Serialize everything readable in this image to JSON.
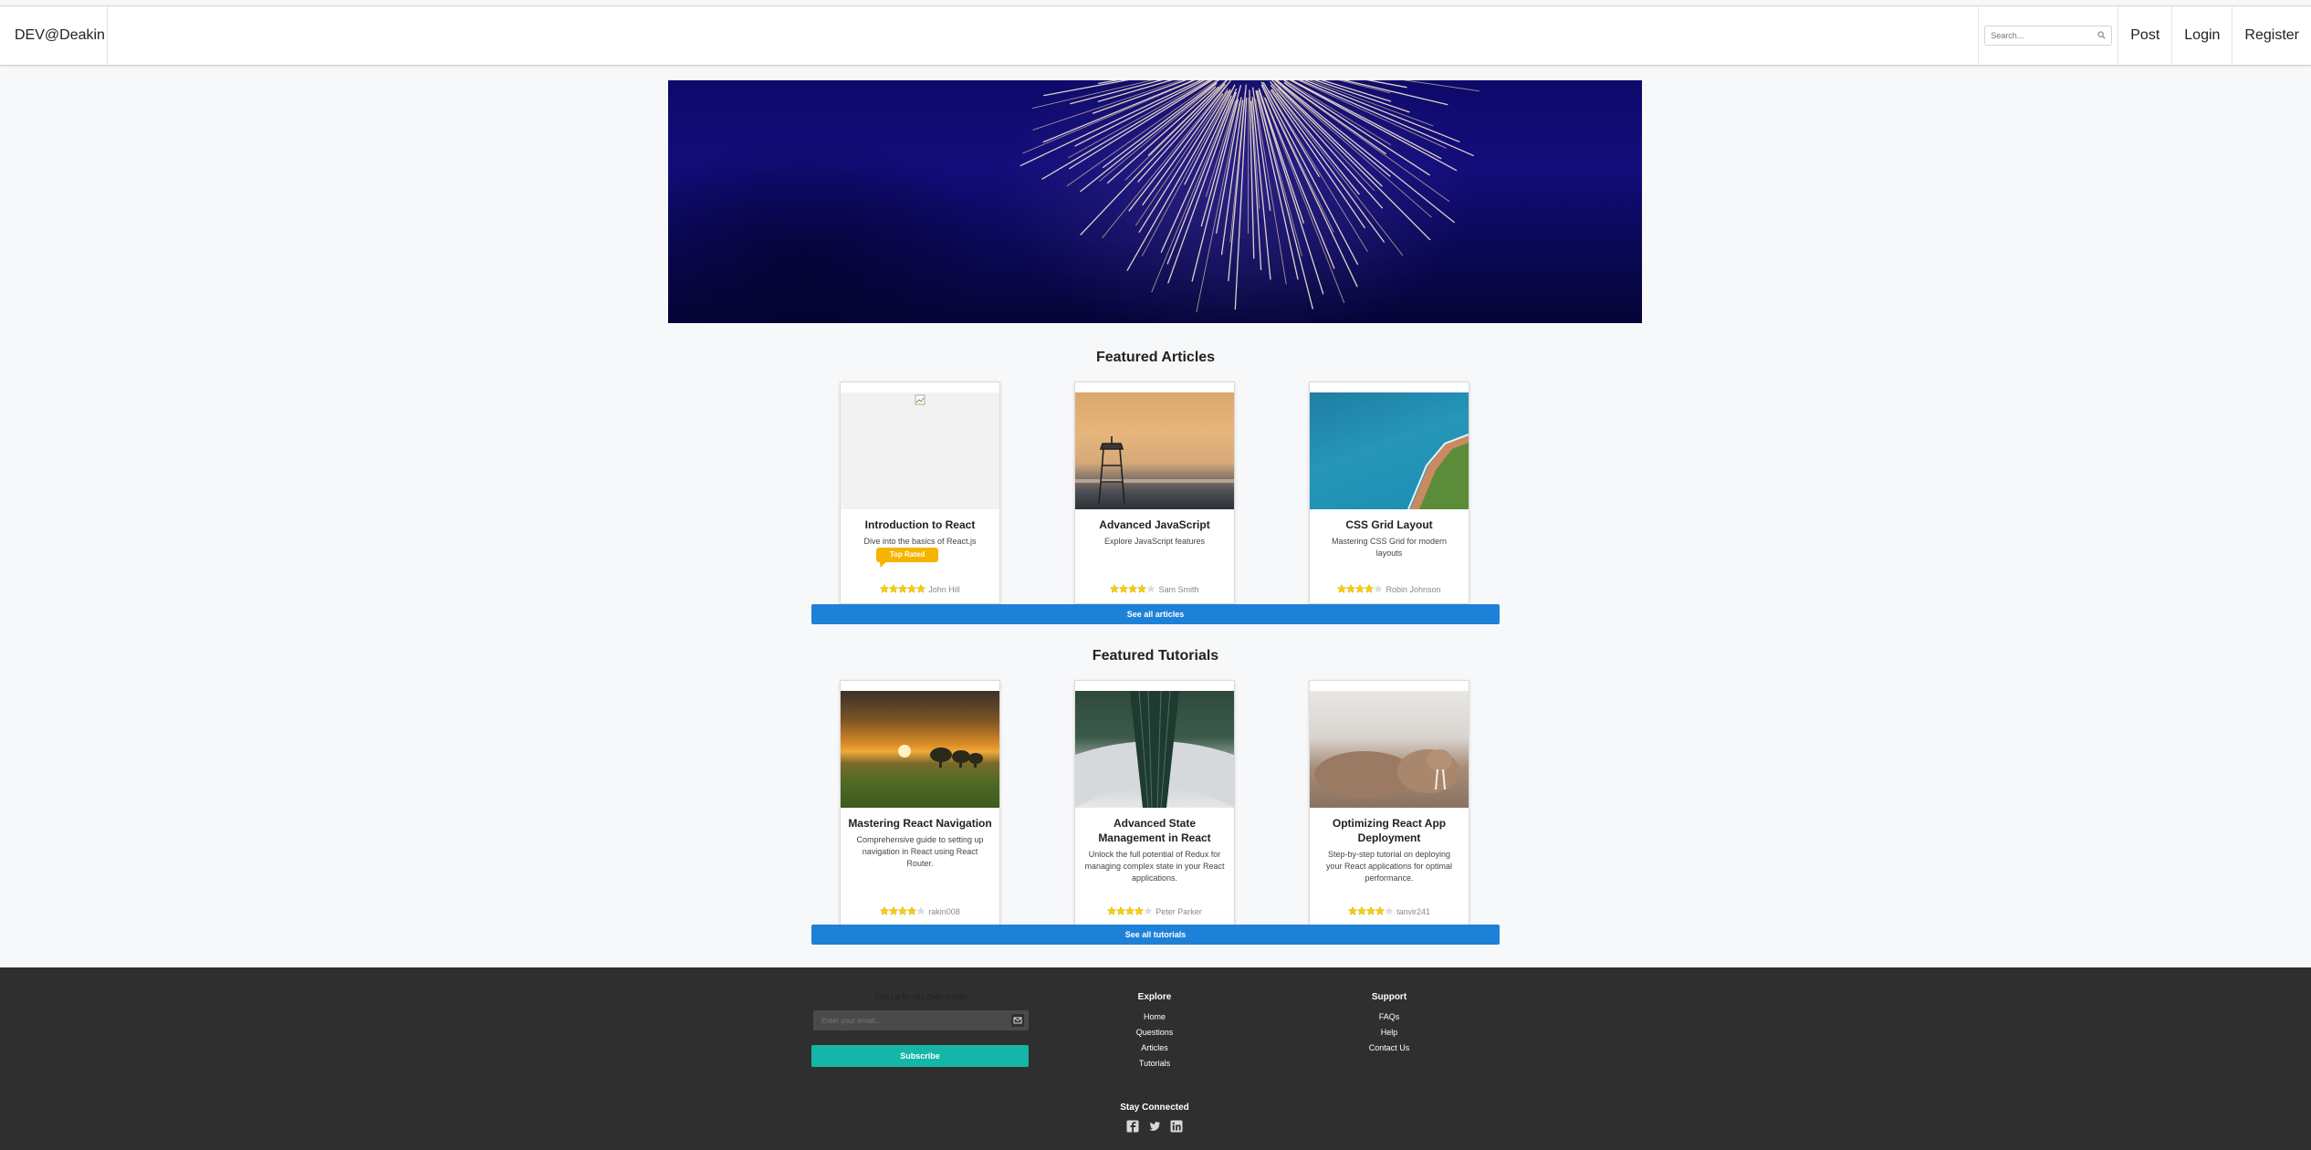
{
  "nav": {
    "brand": "DEV@Deakin",
    "search_placeholder": "Search...",
    "links": [
      "Post",
      "Login",
      "Register"
    ]
  },
  "featured_articles": {
    "title": "Featured Articles",
    "see_all": "See all articles",
    "badge": "Top Rated",
    "cards": [
      {
        "title": "Introduction to React",
        "description": "Dive into the basics of React.js",
        "author": "John Hill",
        "rating": 5
      },
      {
        "title": "Advanced JavaScript",
        "description": "Explore JavaScript features",
        "author": "Sam Smith",
        "rating": 4
      },
      {
        "title": "CSS Grid Layout",
        "description": "Mastering CSS Grid for modern layouts",
        "author": "Robin Johnson",
        "rating": 4
      }
    ]
  },
  "featured_tutorials": {
    "title": "Featured Tutorials",
    "see_all": "See all tutorials",
    "cards": [
      {
        "title": "Mastering React Navigation",
        "description": "Comprehensive guide to setting up navigation in React using React Router.",
        "author": "rakin008",
        "rating": 4
      },
      {
        "title": "Advanced State Management in React",
        "description": "Unlock the full potential of Redux for managing complex state in your React applications.",
        "author": "Peter Parker",
        "rating": 4
      },
      {
        "title": "Optimizing React App Deployment",
        "description": "Step-by-step tutorial on deploying your React applications for optimal performance.",
        "author": "tanvir241",
        "rating": 4
      }
    ]
  },
  "footer": {
    "signup_label": "Sign Up for Our Daily Insider",
    "email_placeholder": "Enter your email...",
    "subscribe": "Subscribe",
    "explore_title": "Explore",
    "explore_links": [
      "Home",
      "Questions",
      "Articles",
      "Tutorials"
    ],
    "support_title": "Support",
    "support_links": [
      "FAQs",
      "Help",
      "Contact Us"
    ],
    "stay_connected": "Stay Connected",
    "social_icons": [
      "facebook-icon",
      "twitter-icon",
      "linkedin-icon"
    ]
  },
  "colors": {
    "primary_button": "#1e81d8",
    "subscribe_button": "#14b6a8",
    "footer_bg": "#2f2f2f",
    "badge": "#f5b400",
    "star": "#f7d000"
  }
}
